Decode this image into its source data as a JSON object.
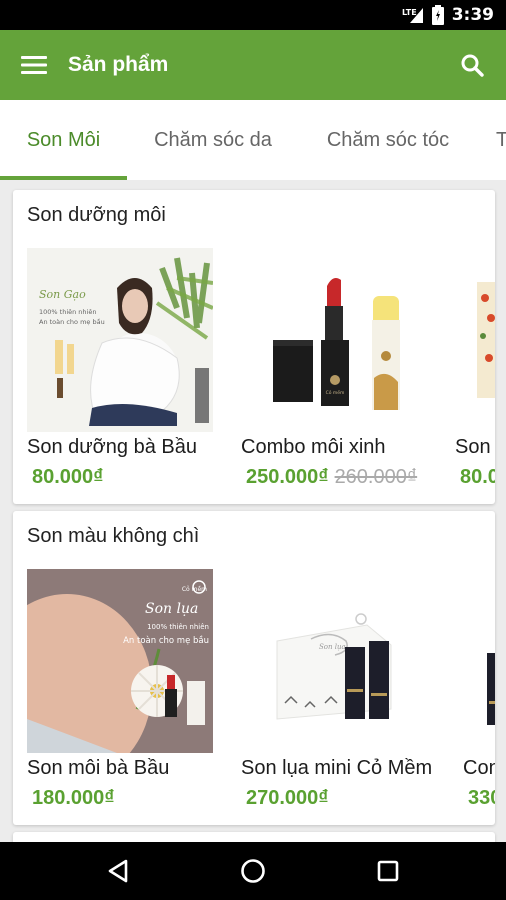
{
  "status_bar": {
    "time": "3:39",
    "network": "LTE"
  },
  "app_bar": {
    "title": "Sản phẩm"
  },
  "tabs": [
    {
      "label": "Son Môi",
      "active": true
    },
    {
      "label": "Chăm sóc da",
      "active": false
    },
    {
      "label": "Chăm sóc tóc",
      "active": false
    },
    {
      "label": "T",
      "active": false
    }
  ],
  "sections": [
    {
      "title": "Son dưỡng môi",
      "products": [
        {
          "name": "Son dưỡng bà Bầu",
          "price": "80.000₫",
          "old_price": "",
          "image_text": {
            "brand": "Son Gạo",
            "line1": "100% thiên nhiên",
            "line2": "An toàn cho mẹ bầu"
          }
        },
        {
          "name": "Combo môi xinh",
          "price": "250.000₫",
          "old_price": "260.000₫",
          "image_text": {
            "brand": "Cỏ mềm"
          }
        },
        {
          "name": "Son",
          "price": "80.0",
          "old_price": ""
        }
      ]
    },
    {
      "title": "Son màu không chì",
      "products": [
        {
          "name": "Son môi bà Bầu",
          "price": "180.000₫",
          "old_price": "",
          "image_text": {
            "brand": "Son lụa",
            "line1": "100% thiên nhiên",
            "line2": "An toàn cho mẹ bầu",
            "logo": "Cỏ mềm"
          }
        },
        {
          "name": "Son lụa mini Cỏ Mềm",
          "price": "270.000₫",
          "old_price": "",
          "image_text": {
            "brand": "Son lụa"
          }
        },
        {
          "name": "Con",
          "price": "330",
          "old_price": ""
        }
      ]
    }
  ],
  "colors": {
    "primary": "#64a33a",
    "price": "#5aa131",
    "accent_tab": "#4b8b2a"
  }
}
